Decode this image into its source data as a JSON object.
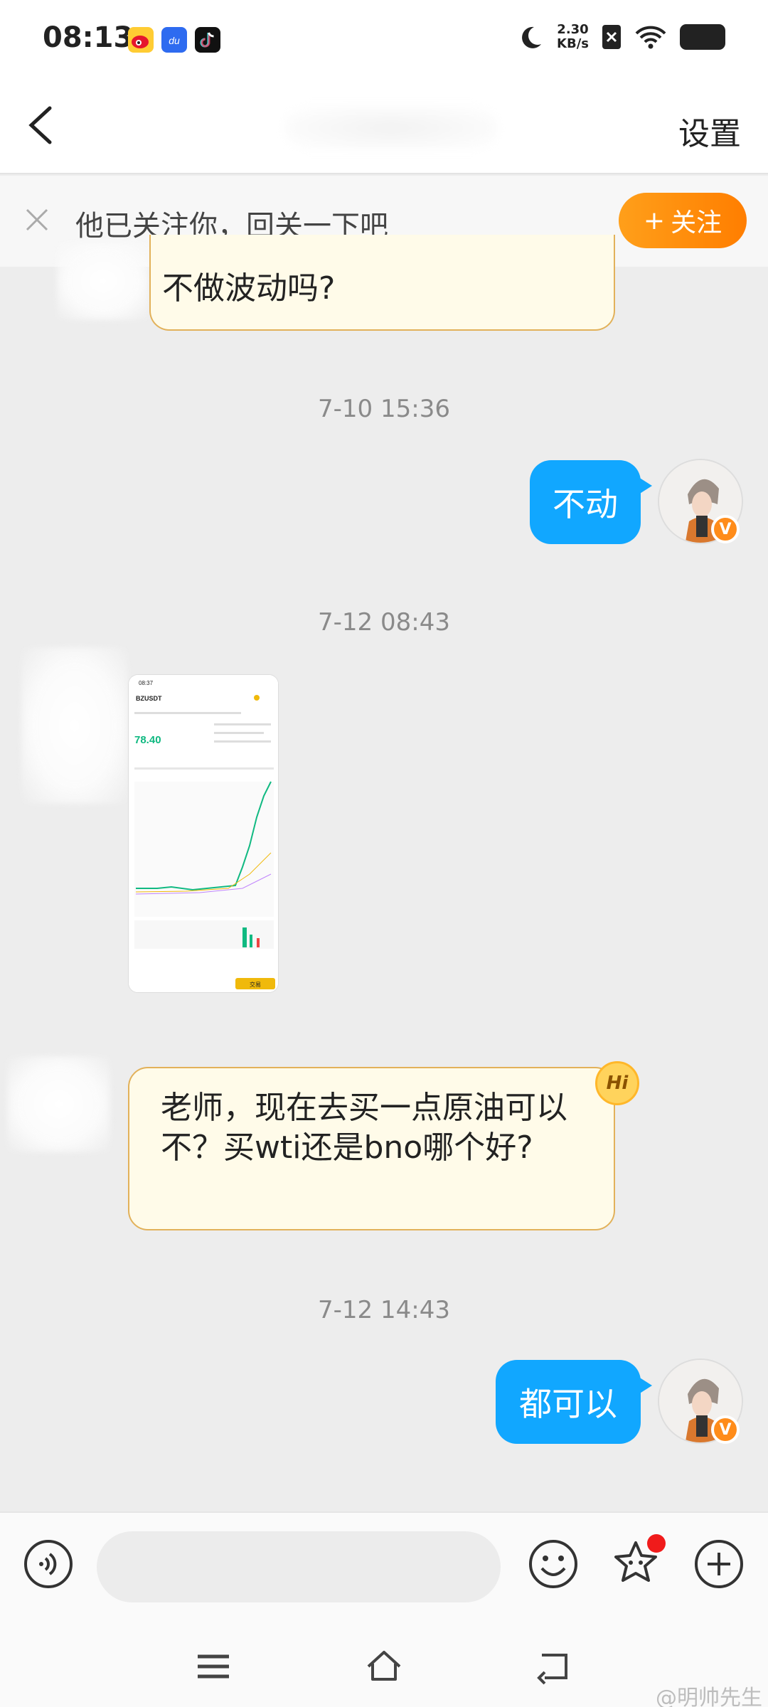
{
  "status_bar": {
    "time": "08:13",
    "net_speed_value": "2.30",
    "net_speed_unit": "KB/s",
    "icons": [
      "weibo-app-icon",
      "baidu-du-app-icon",
      "tiktok-app-icon",
      "moon-icon",
      "sim-x-icon",
      "wifi-icon",
      "battery-icon"
    ]
  },
  "header": {
    "settings_label": "设置"
  },
  "follow_banner": {
    "text": "他已关注你，回关一下吧",
    "follow_button_label": "关注",
    "follow_button_plus": "+"
  },
  "messages": {
    "msg1_text": "不做波动吗?",
    "ts1": "7-10 15:36",
    "msg2_text": "不动",
    "ts2": "7-12 08:43",
    "ts3": "7-12 14:43",
    "msg3_text": "老师，现在去买一点原油可以不？买wti还是bno哪个好?",
    "msg4_text": "都可以",
    "hi_badge": "Hi",
    "verified_badge": "V"
  },
  "image_message": {
    "phone_time": "08:37",
    "symbol": "BZUSDT",
    "price": "78.40",
    "trade_button": "交易"
  },
  "input_bar": {
    "placeholder": ""
  },
  "watermark": "@明帅先生",
  "colors": {
    "outgoing_bubble": "#11a7ff",
    "incoming_bubble": "#fffbe9",
    "incoming_border": "#e2b15a",
    "follow_button": "#ff8c00",
    "badge_dot": "#f01b1b"
  }
}
